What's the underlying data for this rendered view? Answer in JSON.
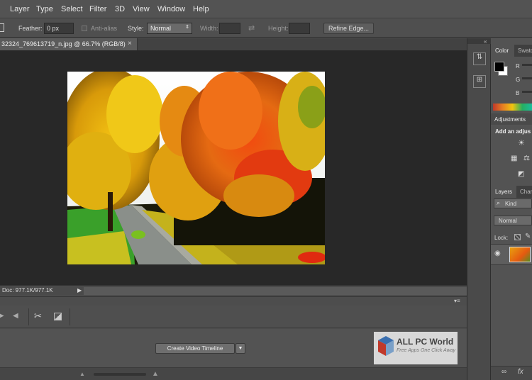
{
  "menu": [
    "Layer",
    "Type",
    "Select",
    "Filter",
    "3D",
    "View",
    "Window",
    "Help"
  ],
  "options": {
    "feather_label": "Feather:",
    "feather_value": "0 px",
    "antialias_label": "Anti-alias",
    "style_label": "Style:",
    "style_value": "Normal",
    "width_label": "Width:",
    "height_label": "Height:",
    "refine_edge_label": "Refine Edge..."
  },
  "document": {
    "tab_title": "32324_769613719_n.jpg @ 66.7% (RGB/8)",
    "close_glyph": "×"
  },
  "status": {
    "doc_info": "Doc: 977.1K/977.1K",
    "arrow": "▶"
  },
  "timeline": {
    "create_button_label": "Create Video Timeline",
    "dropdown_glyph": "▼"
  },
  "panels": {
    "color_tab": "Color",
    "swatches_tab": "Swatc",
    "channel_labels": [
      "R",
      "G",
      "B"
    ],
    "adjustments_title": "Adjustments",
    "add_adjustment_label": "Add an adjus",
    "layers_tab": "Layers",
    "channels_tab": "Chan",
    "kind_label": "Kind",
    "blend_mode": "Normal",
    "lock_label": "Lock:"
  },
  "watermark": {
    "title": "ALL PC World",
    "subtitle": "Free Apps One Click Away"
  },
  "colors": {
    "accent_brand": "#3a6fb0",
    "foreground_swatch": "#000000",
    "background_swatch": "#ffffff"
  }
}
